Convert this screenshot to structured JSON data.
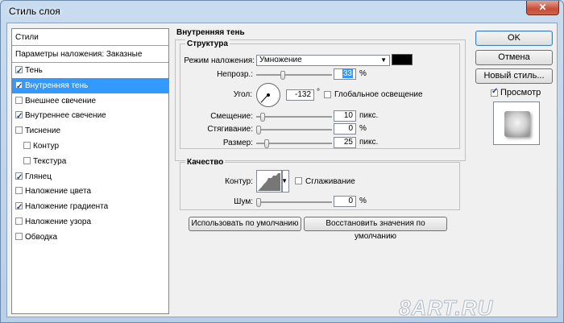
{
  "window": {
    "title": "Стиль слоя",
    "close_glyph": "✕"
  },
  "left_panel": {
    "header": "Стили",
    "blend_options": "Параметры наложения: Заказные",
    "items": [
      {
        "label": "Тень",
        "checked": true,
        "indent": false,
        "selected": false
      },
      {
        "label": "Внутренняя тень",
        "checked": true,
        "indent": false,
        "selected": true
      },
      {
        "label": "Внешнее свечение",
        "checked": false,
        "indent": false,
        "selected": false
      },
      {
        "label": "Внутреннее свечение",
        "checked": true,
        "indent": false,
        "selected": false
      },
      {
        "label": "Тиснение",
        "checked": false,
        "indent": false,
        "selected": false
      },
      {
        "label": "Контур",
        "checked": false,
        "indent": true,
        "selected": false
      },
      {
        "label": "Текстура",
        "checked": false,
        "indent": true,
        "selected": false
      },
      {
        "label": "Глянец",
        "checked": true,
        "indent": false,
        "selected": false
      },
      {
        "label": "Наложение цвета",
        "checked": false,
        "indent": false,
        "selected": false
      },
      {
        "label": "Наложение градиента",
        "checked": true,
        "indent": false,
        "selected": false
      },
      {
        "label": "Наложение узора",
        "checked": false,
        "indent": false,
        "selected": false
      },
      {
        "label": "Обводка",
        "checked": false,
        "indent": false,
        "selected": false
      }
    ]
  },
  "inner_shadow": {
    "title": "Внутренняя тень",
    "structure": {
      "title": "Структура",
      "blend_mode_label": "Режим наложения:",
      "blend_mode_value": "Умножение",
      "shadow_color": "#000000",
      "opacity_label": "Непрозр.:",
      "opacity_value": "33",
      "opacity_unit": "%",
      "opacity_level": 33,
      "angle_label": "Угол:",
      "angle_value": "-132",
      "angle_unit": "°",
      "global_light_label": "Глобальное освещение",
      "global_light_checked": false,
      "distance_label": "Смещение:",
      "distance_value": "10",
      "distance_unit": "пикс.",
      "choke_label": "Стягивание:",
      "choke_value": "0",
      "choke_unit": "%",
      "size_label": "Размер:",
      "size_value": "25",
      "size_unit": "пикс."
    },
    "quality": {
      "title": "Качество",
      "contour_label": "Контур:",
      "antialias_label": "Сглаживание",
      "antialias_checked": false,
      "noise_label": "Шум:",
      "noise_value": "0",
      "noise_unit": "%"
    },
    "make_default_label": "Использовать по умолчанию",
    "reset_default_label": "Восстановить значения по умолчанию"
  },
  "buttons": {
    "ok": "OK",
    "cancel": "Отмена",
    "new_style": "Новый стиль...",
    "preview_label": "Просмотр",
    "preview_checked": true
  },
  "watermark": "8ART.RU"
}
